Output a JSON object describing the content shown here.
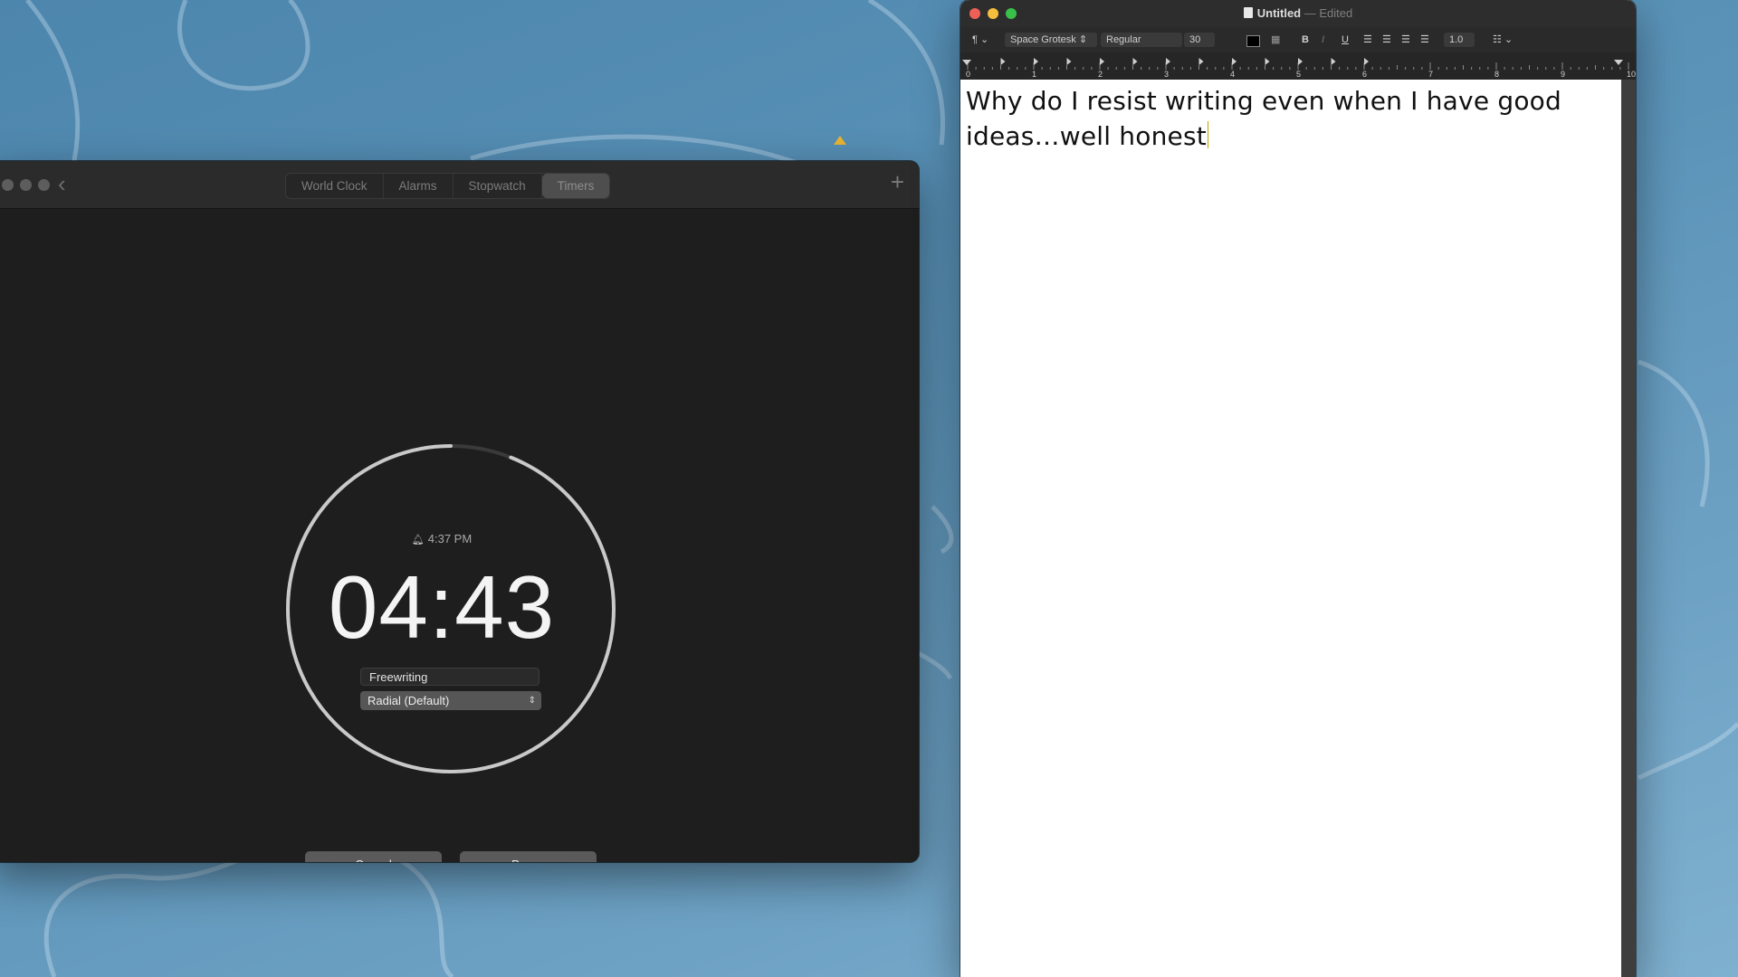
{
  "desktop": {
    "wallpaper_color": "#5b93b8"
  },
  "clock_app": {
    "tabs": [
      {
        "label": "World Clock"
      },
      {
        "label": "Alarms"
      },
      {
        "label": "Stopwatch"
      },
      {
        "label": "Timers"
      }
    ],
    "active_tab": "Timers",
    "timer": {
      "alarm_time": "4:37 PM",
      "remaining": "04:43",
      "progress_fraction": 0.94,
      "label": "Freewriting",
      "style": "Radial (Default)"
    },
    "buttons": {
      "cancel": "Cancel",
      "pause": "Pause"
    }
  },
  "textedit": {
    "title": "Untitled",
    "separator": "—",
    "status": "Edited",
    "toolbar": {
      "paragraph_style": "¶",
      "font_family": "Space Grotesk",
      "font_style": "Regular",
      "font_size": "30",
      "bold": "B",
      "italic": "I",
      "underline": "U",
      "line_spacing": "1.0",
      "text_color": "#000000"
    },
    "ruler_labels": [
      "0",
      "1",
      "2",
      "3",
      "4",
      "5",
      "6",
      "7",
      "8",
      "9",
      "10"
    ],
    "document_text": "Why do I resist writing even when I have good ideas…well honest"
  }
}
